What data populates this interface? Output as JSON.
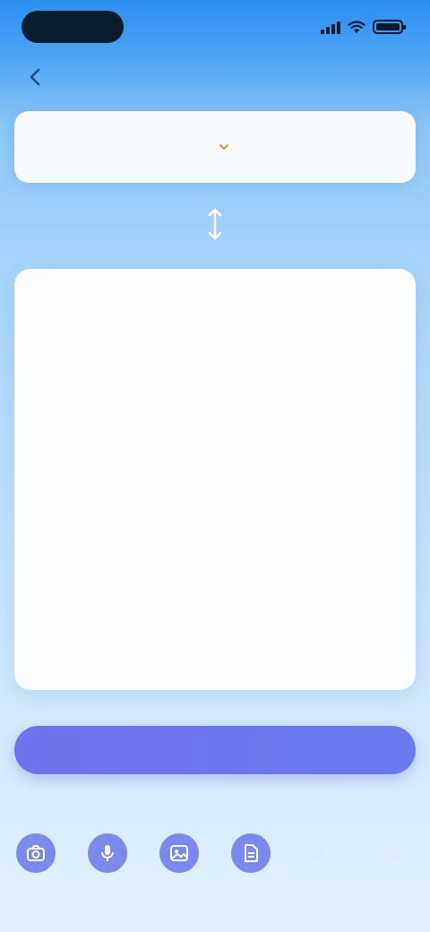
{
  "status_bar": {
    "time": "",
    "icons": [
      "signal-icon",
      "wifi-icon",
      "battery-icon"
    ]
  },
  "header": {
    "back_icon": "arrow-left-icon"
  },
  "language_selector": {
    "from": "",
    "to": "",
    "dropdown_icon": "chevron-down-icon"
  },
  "swap": {
    "icon": "swap-vertical-icon"
  },
  "text_area": {
    "value": "",
    "placeholder": ""
  },
  "translate_button": {
    "label": ""
  },
  "hint": {
    "text": ""
  },
  "tools": [
    {
      "icon": "camera-icon",
      "label": ""
    },
    {
      "icon": "microphone-icon",
      "label": ""
    },
    {
      "icon": "image-icon",
      "label": ""
    },
    {
      "icon": "document-icon",
      "label": ""
    },
    {
      "icon": "history-icon",
      "label": ""
    },
    {
      "icon": "star-icon",
      "label": ""
    }
  ],
  "colors": {
    "accent": "#6f72ea",
    "target_language": "#e0922a",
    "card": "#f7fbff",
    "header_top": "#2c8ff0"
  }
}
